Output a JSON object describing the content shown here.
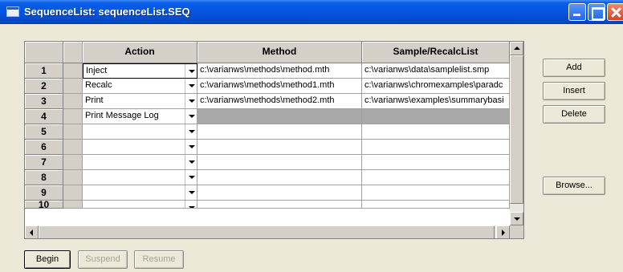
{
  "window": {
    "title": "SequenceList: sequenceList.SEQ"
  },
  "grid": {
    "columns": [
      "",
      "Action",
      "Method",
      "Sample/RecalcList"
    ],
    "rows": [
      {
        "num": "1",
        "action": "Inject",
        "method": "c:\\varianws\\methods\\method.mth",
        "sample": "c:\\varianws\\data\\samplelist.smp"
      },
      {
        "num": "2",
        "action": "Recalc",
        "method": "c:\\varianws\\methods\\method1.mth",
        "sample": "c:\\varianws\\chromexamples\\paradc"
      },
      {
        "num": "3",
        "action": "Print",
        "method": "c:\\varianws\\methods\\method2.mth",
        "sample": "c:\\varianws\\examples\\summarybasi"
      },
      {
        "num": "4",
        "action": "Print Message Log",
        "method": "",
        "sample": ""
      },
      {
        "num": "5",
        "action": "",
        "method": "",
        "sample": ""
      },
      {
        "num": "6",
        "action": "",
        "method": "",
        "sample": ""
      },
      {
        "num": "7",
        "action": "",
        "method": "",
        "sample": ""
      },
      {
        "num": "8",
        "action": "",
        "method": "",
        "sample": ""
      },
      {
        "num": "9",
        "action": "",
        "method": "",
        "sample": ""
      },
      {
        "num": "10",
        "action": "",
        "method": "",
        "sample": ""
      }
    ]
  },
  "side_buttons": {
    "add": "Add",
    "insert": "Insert",
    "delete": "Delete",
    "browse": "Browse..."
  },
  "bottom_buttons": {
    "begin": "Begin",
    "suspend": "Suspend",
    "resume": "Resume"
  }
}
